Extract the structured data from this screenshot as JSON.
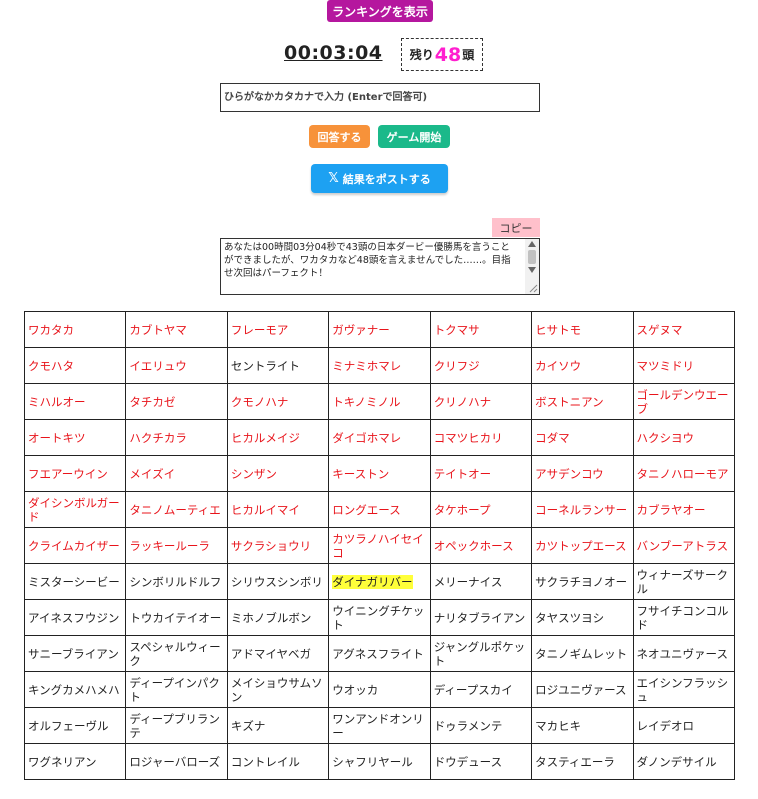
{
  "ranking_button": "ランキングを表示",
  "timer": "00:03:04",
  "remaining": {
    "prefix": "残り",
    "count": "48",
    "suffix": "頭"
  },
  "input": {
    "placeholder": "ひらがなかカタカナで入力 (Enterで回答可)"
  },
  "buttons": {
    "answer": "回答する",
    "start": "ゲーム開始",
    "post_icon": "𝕏",
    "post": "結果をポストする",
    "copy": "コピー"
  },
  "result_text": "あなたは00時間03分04秒で43頭の日本ダービー優勝馬を言うことができましたが、ワカタカなど48頭を言えませんでした……。目指せ次回はパーフェクト！",
  "colors": {
    "answered": "#e8141b",
    "unanswered": "#222222",
    "highlight": "#ffff3a"
  },
  "rows": [
    [
      {
        "name": "ワカタカ",
        "ok": true
      },
      {
        "name": "カブトヤマ",
        "ok": true
      },
      {
        "name": "フレーモア",
        "ok": true
      },
      {
        "name": "ガヴァナー",
        "ok": true
      },
      {
        "name": "トクマサ",
        "ok": true
      },
      {
        "name": "ヒサトモ",
        "ok": true
      },
      {
        "name": "スゲヌマ",
        "ok": true
      }
    ],
    [
      {
        "name": "クモハタ",
        "ok": true
      },
      {
        "name": "イエリュウ",
        "ok": true
      },
      {
        "name": "セントライト",
        "ok": false
      },
      {
        "name": "ミナミホマレ",
        "ok": true
      },
      {
        "name": "クリフジ",
        "ok": true
      },
      {
        "name": "カイソウ",
        "ok": true
      },
      {
        "name": "マツミドリ",
        "ok": true
      }
    ],
    [
      {
        "name": "ミハルオー",
        "ok": true
      },
      {
        "name": "タチカゼ",
        "ok": true
      },
      {
        "name": "クモノハナ",
        "ok": true
      },
      {
        "name": "トキノミノル",
        "ok": true
      },
      {
        "name": "クリノハナ",
        "ok": true
      },
      {
        "name": "ボストニアン",
        "ok": true
      },
      {
        "name": "ゴールデンウエーブ",
        "ok": true
      }
    ],
    [
      {
        "name": "オートキツ",
        "ok": true
      },
      {
        "name": "ハクチカラ",
        "ok": true
      },
      {
        "name": "ヒカルメイジ",
        "ok": true
      },
      {
        "name": "ダイゴホマレ",
        "ok": true
      },
      {
        "name": "コマツヒカリ",
        "ok": true
      },
      {
        "name": "コダマ",
        "ok": true
      },
      {
        "name": "ハクシヨウ",
        "ok": true
      }
    ],
    [
      {
        "name": "フエアーウイン",
        "ok": true
      },
      {
        "name": "メイズイ",
        "ok": true
      },
      {
        "name": "シンザン",
        "ok": true
      },
      {
        "name": "キーストン",
        "ok": true
      },
      {
        "name": "テイトオー",
        "ok": true
      },
      {
        "name": "アサデンコウ",
        "ok": true
      },
      {
        "name": "タニノハローモア",
        "ok": true
      }
    ],
    [
      {
        "name": "ダイシンボルガード",
        "ok": true
      },
      {
        "name": "タニノムーティエ",
        "ok": true
      },
      {
        "name": "ヒカルイマイ",
        "ok": true
      },
      {
        "name": "ロングエース",
        "ok": true
      },
      {
        "name": "タケホープ",
        "ok": true
      },
      {
        "name": "コーネルランサー",
        "ok": true
      },
      {
        "name": "カブラヤオー",
        "ok": true
      }
    ],
    [
      {
        "name": "クライムカイザー",
        "ok": true
      },
      {
        "name": "ラッキールーラ",
        "ok": true
      },
      {
        "name": "サクラショウリ",
        "ok": true
      },
      {
        "name": "カツラノハイセイコ",
        "ok": true
      },
      {
        "name": "オペックホース",
        "ok": true
      },
      {
        "name": "カツトップエース",
        "ok": true
      },
      {
        "name": "バンブーアトラス",
        "ok": true
      }
    ],
    [
      {
        "name": "ミスターシービー",
        "ok": false
      },
      {
        "name": "シンボリルドルフ",
        "ok": false
      },
      {
        "name": "シリウスシンボリ",
        "ok": false
      },
      {
        "name": "ダイナガリバー",
        "ok": false,
        "hl": true
      },
      {
        "name": "メリーナイス",
        "ok": false
      },
      {
        "name": "サクラチヨノオー",
        "ok": false
      },
      {
        "name": "ウィナーズサークル",
        "ok": false
      }
    ],
    [
      {
        "name": "アイネスフウジン",
        "ok": false
      },
      {
        "name": "トウカイテイオー",
        "ok": false
      },
      {
        "name": "ミホノブルボン",
        "ok": false
      },
      {
        "name": "ウイニングチケット",
        "ok": false
      },
      {
        "name": "ナリタブライアン",
        "ok": false
      },
      {
        "name": "タヤスツヨシ",
        "ok": false
      },
      {
        "name": "フサイチコンコルド",
        "ok": false
      }
    ],
    [
      {
        "name": "サニーブライアン",
        "ok": false
      },
      {
        "name": "スペシャルウィーク",
        "ok": false
      },
      {
        "name": "アドマイヤベガ",
        "ok": false
      },
      {
        "name": "アグネスフライト",
        "ok": false
      },
      {
        "name": "ジャングルポケット",
        "ok": false
      },
      {
        "name": "タニノギムレット",
        "ok": false
      },
      {
        "name": "ネオユニヴァース",
        "ok": false
      }
    ],
    [
      {
        "name": "キングカメハメハ",
        "ok": false
      },
      {
        "name": "ディープインパクト",
        "ok": false
      },
      {
        "name": "メイショウサムソン",
        "ok": false
      },
      {
        "name": "ウオッカ",
        "ok": false
      },
      {
        "name": "ディープスカイ",
        "ok": false
      },
      {
        "name": "ロジユニヴァース",
        "ok": false
      },
      {
        "name": "エイシンフラッシュ",
        "ok": false
      }
    ],
    [
      {
        "name": "オルフェーヴル",
        "ok": false
      },
      {
        "name": "ディープブリランテ",
        "ok": false
      },
      {
        "name": "キズナ",
        "ok": false
      },
      {
        "name": "ワンアンドオンリー",
        "ok": false
      },
      {
        "name": "ドゥラメンテ",
        "ok": false
      },
      {
        "name": "マカヒキ",
        "ok": false
      },
      {
        "name": "レイデオロ",
        "ok": false
      }
    ],
    [
      {
        "name": "ワグネリアン",
        "ok": false
      },
      {
        "name": "ロジャーバローズ",
        "ok": false
      },
      {
        "name": "コントレイル",
        "ok": false
      },
      {
        "name": "シャフリヤール",
        "ok": false
      },
      {
        "name": "ドウデュース",
        "ok": false
      },
      {
        "name": "タスティエーラ",
        "ok": false
      },
      {
        "name": "ダノンデサイル",
        "ok": false
      }
    ]
  ]
}
